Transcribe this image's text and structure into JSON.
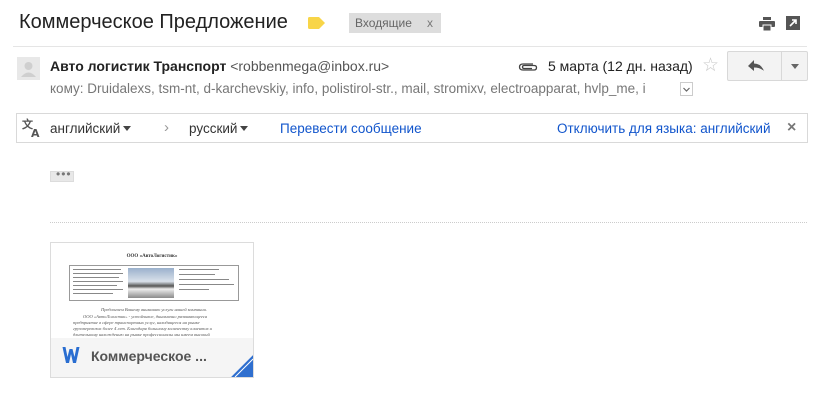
{
  "header": {
    "subject": "Коммерческое Предложение",
    "label": "Входящие",
    "label_remove": "x",
    "colors": {
      "label_tag": "#f8d548",
      "label_chip_bg": "#dddddd"
    }
  },
  "message": {
    "sender_name": "Авто логистик Транспорт",
    "sender_email": "<robbenmega@inbox.ru>",
    "date": "5 марта (12 дн. назад)",
    "recipients": "кому: Druidalexs, tsm-nt, d-karchevskiy, info, polistirol-str., mail, stromixv, electroapparat, hvlp_me, i",
    "star": "☆"
  },
  "translate_bar": {
    "source_lang": "английский",
    "target_lang": "русский",
    "arrow": "›",
    "translate_link": "Перевести сообщение",
    "disable_link": "Отключить для языка: английский",
    "close": "×",
    "colors": {
      "link": "#1155cc"
    }
  },
  "quoted_toggle": "•••",
  "attachment": {
    "name": "Коммерческое ...",
    "preview": {
      "company": "ООО «АвтоЛогистик»",
      "paragraph_lines": [
        "Предлагаем Вашему вниманию услуги нашей компании.",
        "ООО «АвтоЛогистик» - устойчивое, динамично развивающееся",
        "предприятие в сфере транспортных услуг, находящееся на рынке",
        "грузоперевозок более 4 лет. Благодаря большому количеству клиентов и",
        "длительному нахождению на рынке профессионалы мы имеем высокий"
      ]
    }
  },
  "icons": {
    "label_tag": "label-tag-icon",
    "print": "print-icon",
    "popout": "popout-icon",
    "attachment": "paperclip-icon",
    "reply": "reply-icon",
    "translate": "translate-icon",
    "word": "word-doc-icon"
  }
}
